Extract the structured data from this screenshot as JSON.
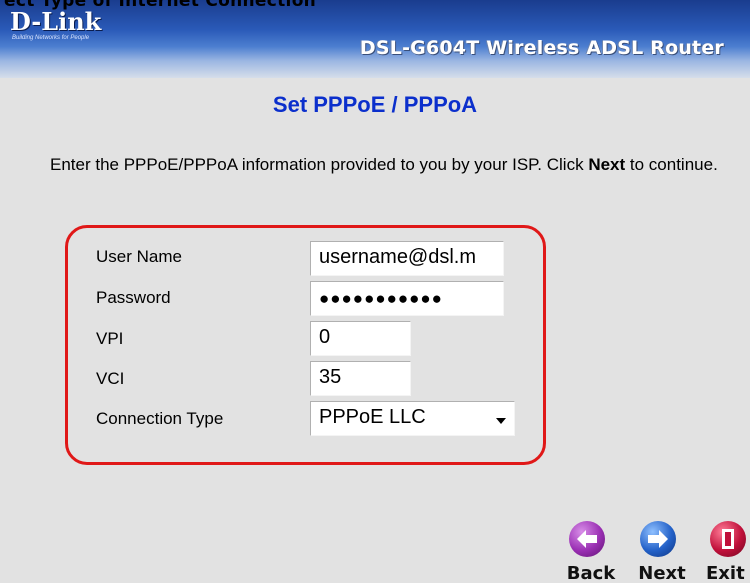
{
  "header": {
    "caption": "ect Type of Internet Connection",
    "logo": "D-Link",
    "logo_tagline": "Building Networks for People",
    "product_name": "DSL-G604T Wireless ADSL Router"
  },
  "page_title": "Set PPPoE / PPPoA",
  "intro": {
    "text_before": "Enter the PPPoE/PPPoA information provided to you by your ISP. Click ",
    "bold": "Next",
    "text_after": " to continue."
  },
  "form": {
    "username": {
      "label": "User Name",
      "value": "username@dsl.m"
    },
    "password": {
      "label": "Password",
      "value": "●●●●●●●●●●●"
    },
    "vpi": {
      "label": "VPI",
      "value": "0"
    },
    "vci": {
      "label": "VCI",
      "value": "35"
    },
    "connection_type": {
      "label": "Connection Type",
      "value": "PPPoE LLC"
    }
  },
  "nav": {
    "back": {
      "label": "Back",
      "icon": "back-arrow-icon",
      "color": "#9a2fb3"
    },
    "next": {
      "label": "Next",
      "icon": "next-arrow-icon",
      "color": "#2361c8"
    },
    "exit": {
      "label": "Exit",
      "icon": "exit-door-icon",
      "color": "#c0103a"
    }
  },
  "colors": {
    "title": "#0b2fcc",
    "highlight": "#e01818"
  }
}
